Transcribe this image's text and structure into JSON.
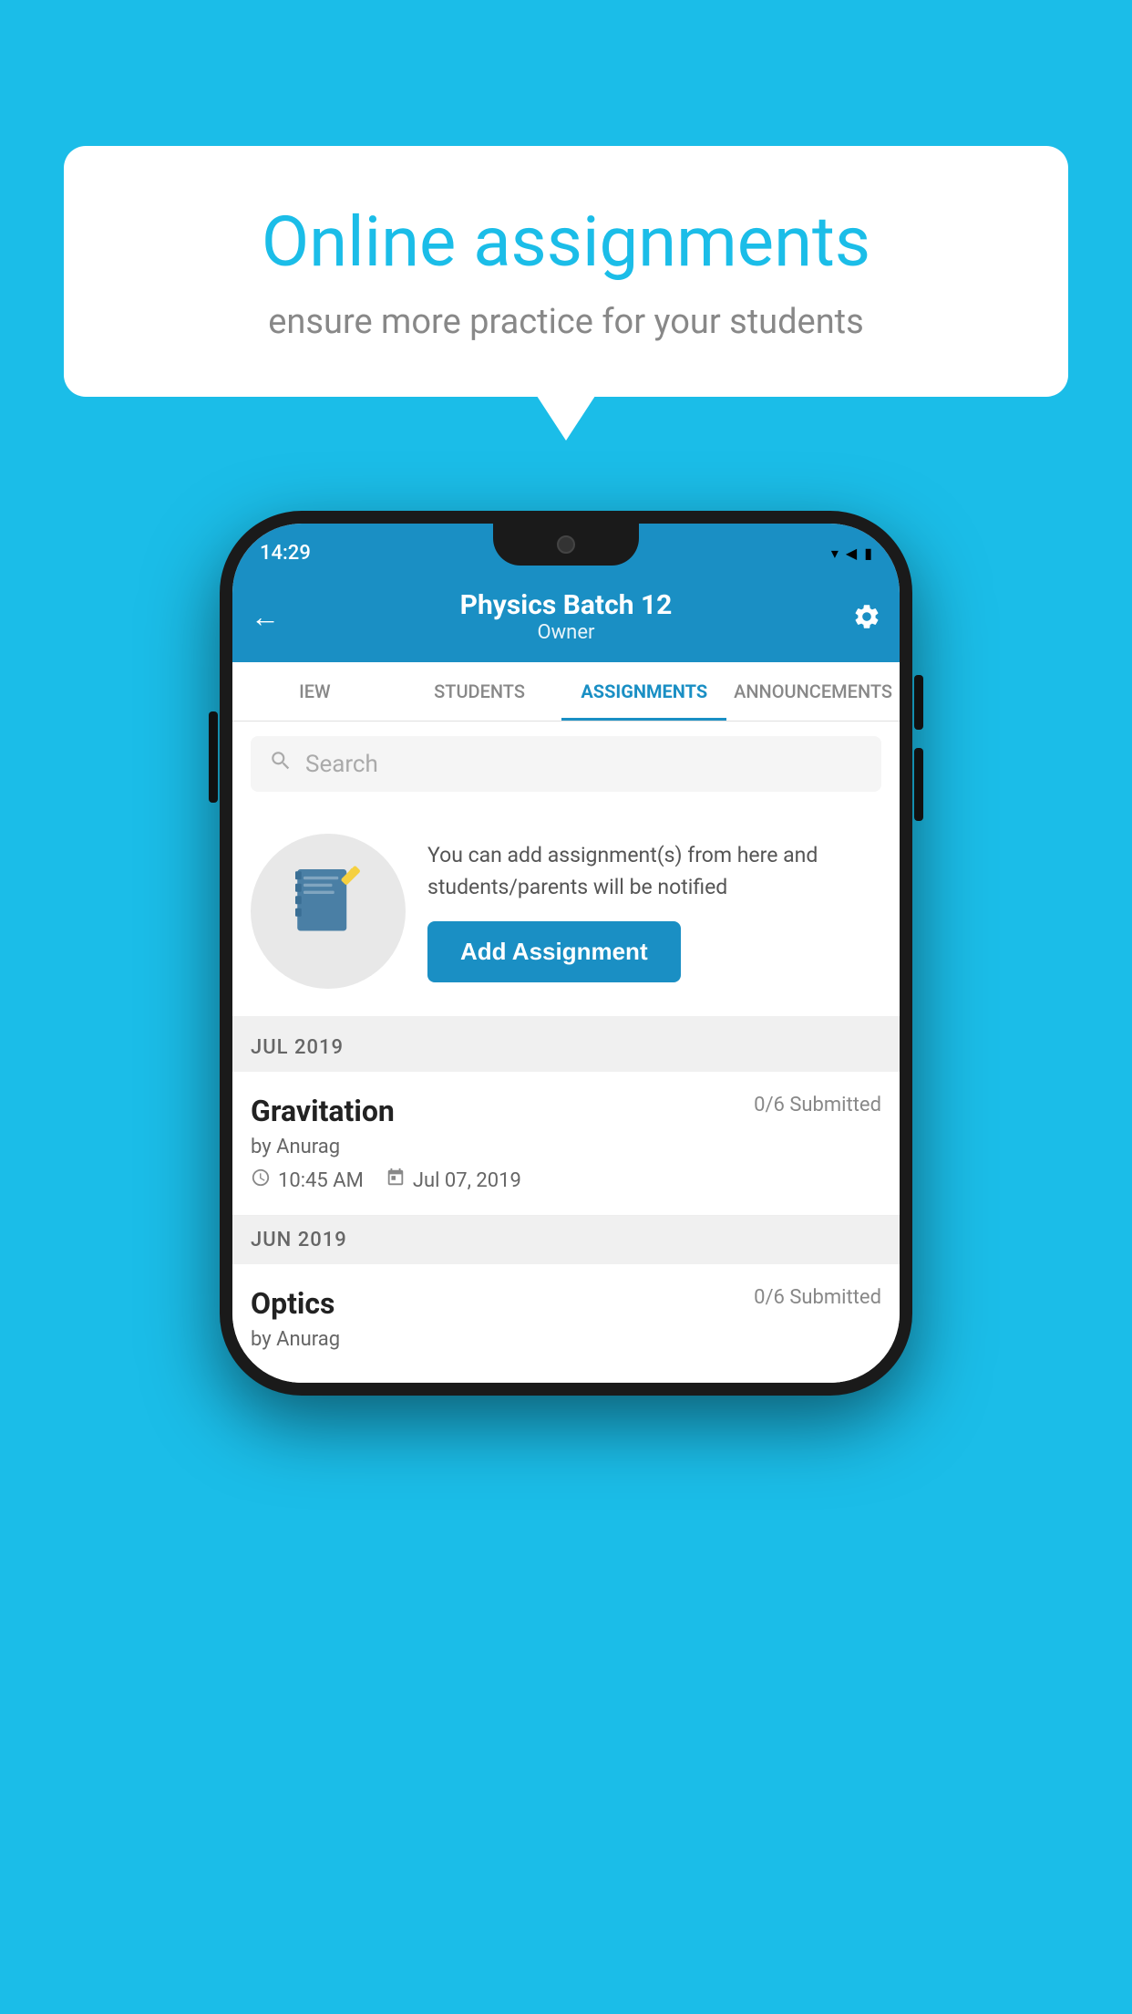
{
  "background": {
    "color": "#1BBDE8"
  },
  "speech_bubble": {
    "title": "Online assignments",
    "subtitle": "ensure more practice for your students"
  },
  "phone": {
    "status_bar": {
      "time": "14:29",
      "wifi": "▾",
      "signal": "▲",
      "battery": "▮"
    },
    "header": {
      "title": "Physics Batch 12",
      "subtitle": "Owner",
      "back_label": "←",
      "settings_label": "⚙"
    },
    "tabs": [
      {
        "label": "IEW",
        "active": false
      },
      {
        "label": "STUDENTS",
        "active": false
      },
      {
        "label": "ASSIGNMENTS",
        "active": true
      },
      {
        "label": "ANNOUNCEMENTS",
        "active": false
      }
    ],
    "search": {
      "placeholder": "Search"
    },
    "promo": {
      "text": "You can add assignment(s) from here and students/parents will be notified",
      "button_label": "Add Assignment"
    },
    "months": [
      {
        "label": "JUL 2019",
        "assignments": [
          {
            "name": "Gravitation",
            "submitted": "0/6 Submitted",
            "by": "by Anurag",
            "time": "10:45 AM",
            "date": "Jul 07, 2019"
          }
        ]
      },
      {
        "label": "JUN 2019",
        "assignments": [
          {
            "name": "Optics",
            "submitted": "0/6 Submitted",
            "by": "by Anurag",
            "time": "",
            "date": ""
          }
        ]
      }
    ]
  }
}
